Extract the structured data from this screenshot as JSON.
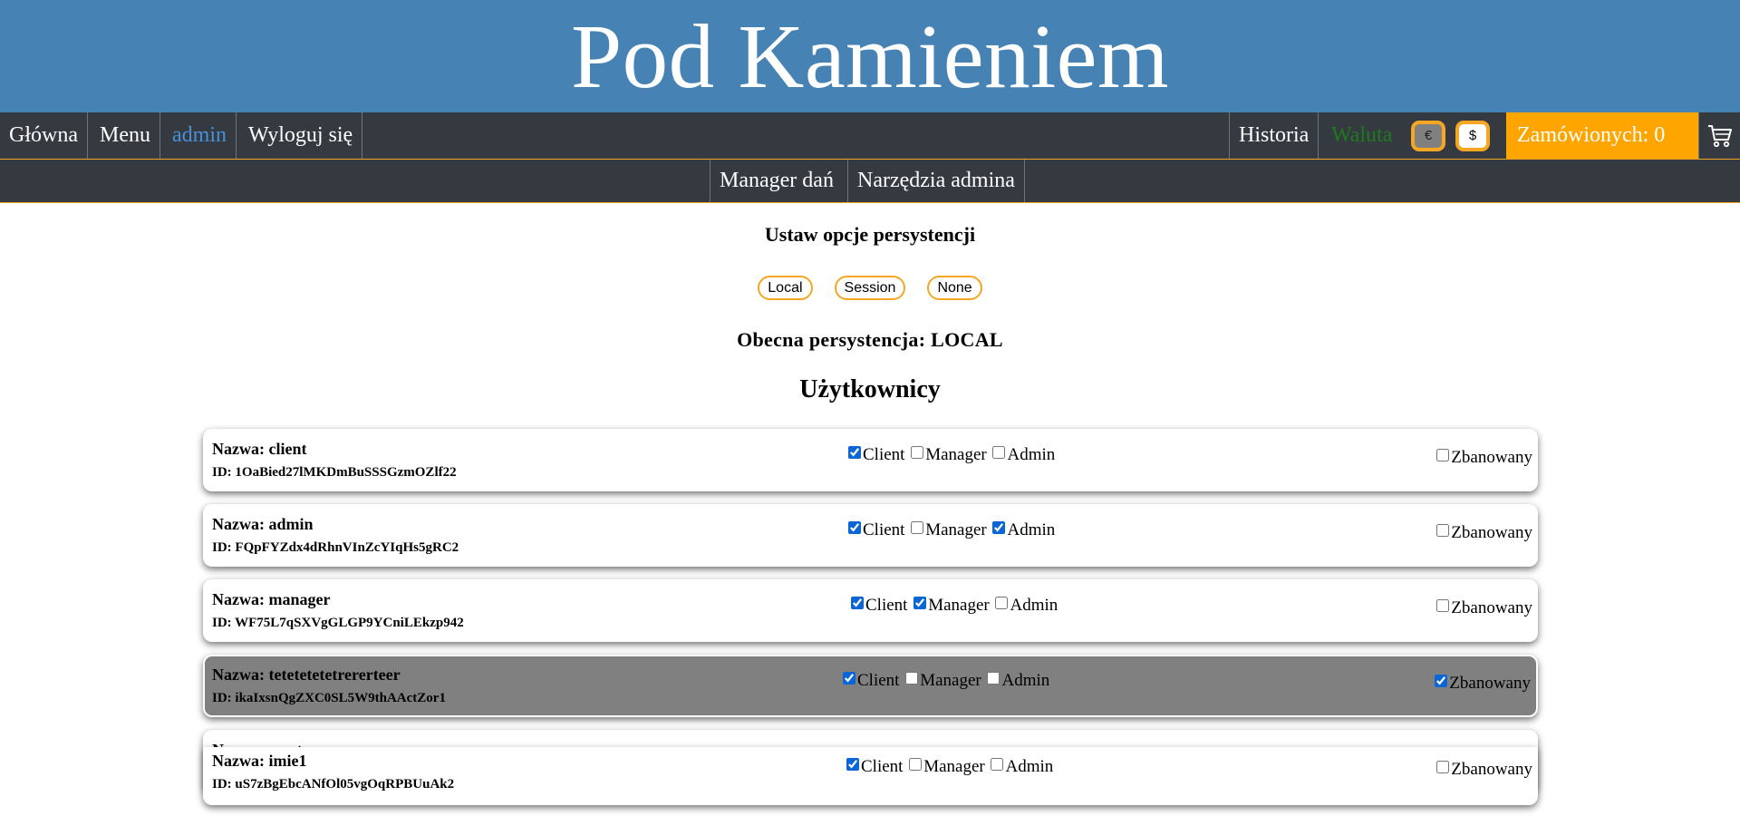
{
  "banner": {
    "title": "Pod Kamieniem"
  },
  "nav": {
    "home": "Główna",
    "menu": "Menu",
    "user": "admin",
    "logout": "Wyloguj się",
    "history": "Historia",
    "currency_label": "Waluta",
    "currency_eur": "€",
    "currency_usd": "$",
    "ordered": "Zamówionych: 0",
    "accent_color": "#ffa500",
    "currency_label_color": "#1f7a1f"
  },
  "subnav": {
    "dish_manager": "Manager dań",
    "admin_tools": "Narzędzia admina"
  },
  "persistence": {
    "title": "Ustaw opcje persystencji",
    "options": [
      "Local",
      "Session",
      "None"
    ],
    "current": "Obecna persystencja: LOCAL"
  },
  "users": {
    "title": "Użytkownicy",
    "role_labels": [
      "Client",
      "Manager",
      "Admin"
    ],
    "ban_label": "Zbanowany",
    "list": [
      {
        "name": "Nazwa: client",
        "id": "ID: 1OaBied27lMKDmBuSSSGzmOZlf22",
        "client": true,
        "manager": false,
        "admin": false,
        "banned": false
      },
      {
        "name": "Nazwa: admin",
        "id": "ID: FQpFYZdx4dRhnVInZcYIqHs5gRC2",
        "client": true,
        "manager": false,
        "admin": true,
        "banned": false
      },
      {
        "name": "Nazwa: manager",
        "id": "ID: WF75L7qSXVgGLGP9YCniLEkzp942",
        "client": true,
        "manager": true,
        "admin": false,
        "banned": false
      },
      {
        "name": "Nazwa: tetetetetetrererteer",
        "id": "ID: ikaIxsnQgZXC0SL5W9thAActZor1",
        "client": true,
        "manager": false,
        "admin": false,
        "banned": true
      },
      {
        "name": "Nazwa: master",
        "partially_hidden": true
      },
      {
        "name": "Nazwa: imie1",
        "id": "ID: uS7zBgEbcANfOl05vgOqRPBUuAk2",
        "client": true,
        "manager": false,
        "admin": false,
        "banned": false
      }
    ]
  }
}
